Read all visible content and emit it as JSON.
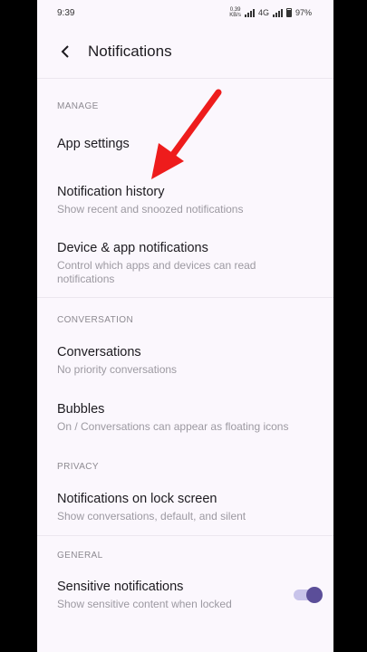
{
  "status": {
    "time": "9:39",
    "speed_value": "0.39",
    "speed_unit": "KB/s",
    "network": "4G",
    "battery": "97%"
  },
  "header": {
    "title": "Notifications"
  },
  "sections": {
    "manage": "MANAGE",
    "conversation": "CONVERSATION",
    "privacy": "PRIVACY",
    "general": "GENERAL"
  },
  "items": {
    "app_settings": {
      "title": "App settings"
    },
    "notification_history": {
      "title": "Notification history",
      "subtitle": "Show recent and snoozed notifications"
    },
    "device_app": {
      "title": "Device & app notifications",
      "subtitle": "Control which apps and devices can read notifications"
    },
    "conversations": {
      "title": "Conversations",
      "subtitle": "No priority conversations"
    },
    "bubbles": {
      "title": "Bubbles",
      "subtitle": "On / Conversations can appear as floating icons"
    },
    "lock_screen": {
      "title": "Notifications on lock screen",
      "subtitle": "Show conversations, default, and silent"
    },
    "sensitive": {
      "title": "Sensitive notifications",
      "subtitle": "Show sensitive content when locked",
      "enabled": true
    }
  },
  "colors": {
    "accent": "#5b4e99",
    "arrow": "#ee1c1c",
    "background": "#fbf7fd"
  }
}
